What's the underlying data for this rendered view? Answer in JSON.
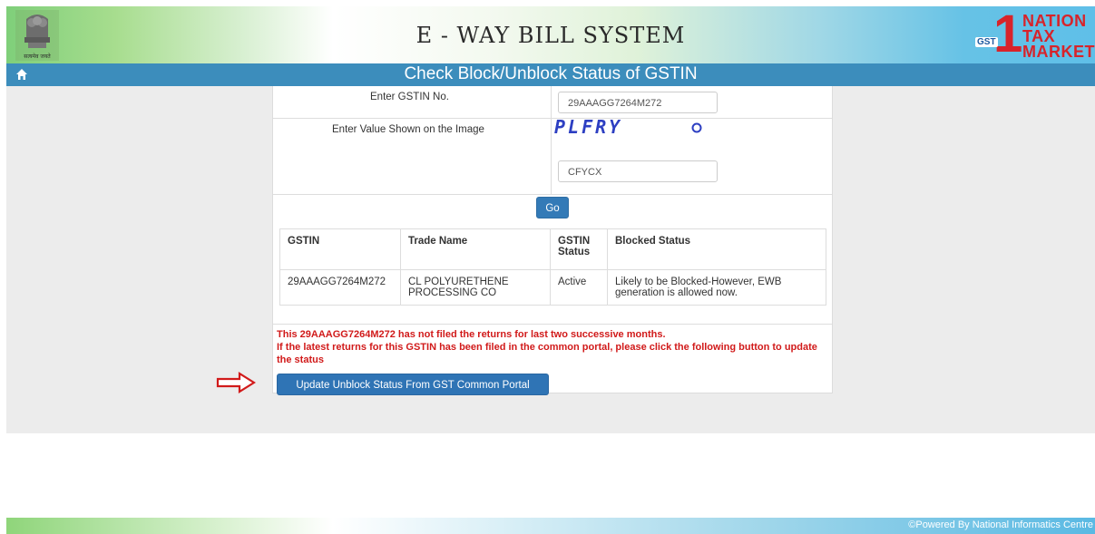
{
  "header": {
    "app_title": "E - WAY BILL SYSTEM",
    "emblem_caption": "सत्यमेव जयते",
    "logo": {
      "prefix": "GST",
      "line1": "NATION",
      "line2": "TAX",
      "line3": "MARKET"
    }
  },
  "titlebar": {
    "page_title": "Check Block/Unblock Status of GSTIN",
    "home_icon": "home-icon"
  },
  "form": {
    "gstin_label": "Enter GSTIN No.",
    "gstin_value": "29AAAGG7264M272",
    "captcha_label": "Enter Value Shown on the Image",
    "captcha_image_text": "PLFRY",
    "captcha_refresh_icon": "refresh-icon",
    "captcha_input_value": "CFYCX",
    "go_button": "Go"
  },
  "table": {
    "headers": [
      "GSTIN",
      "Trade Name",
      "GSTIN Status",
      "Blocked Status"
    ],
    "rows": [
      {
        "gstin": "29AAAGG7264M272",
        "trade_name": "CL POLYURETHENE PROCESSING CO",
        "status": "Active",
        "blocked_status": "Likely to be Blocked-However, EWB generation is allowed now."
      }
    ]
  },
  "notice": {
    "line1": "This 29AAAGG7264M272 has not filed the returns for last two successive months.",
    "line2": "If the latest returns for this GSTIN has been filed in the common portal, please click the following button to update the status"
  },
  "update_button": "Update Unblock Status From GST Common Portal",
  "annotation_arrow_color": "#d11a1a",
  "footer": {
    "powered_by": "©Powered By National Informatics Centre"
  },
  "colors": {
    "titlebar": "#3c8dbc",
    "button": "#337ab7",
    "notice": "#d11a1a"
  }
}
